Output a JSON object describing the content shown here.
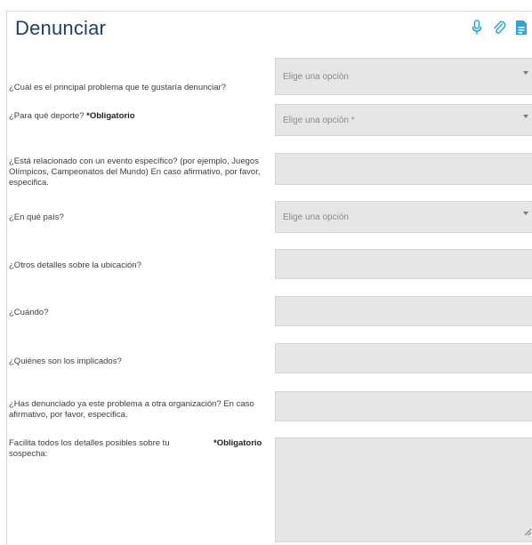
{
  "form": {
    "title": "Denunciar",
    "toolbar": {
      "icons": [
        "microphone-icon",
        "paperclip-icon",
        "document-icon"
      ],
      "accent": "#2aa7d8"
    },
    "questions": [
      {
        "label": "¿Cuál es el principal problema que te gustaría denunciar?",
        "type": "select",
        "placeholder": "Elige una opción"
      },
      {
        "label": "¿Para qué deporte?",
        "required_label": "*Obligatorio",
        "type": "select",
        "placeholder": "Elige una opción *"
      },
      {
        "label": "¿Está relacionado con un evento específico? (por ejemplo, Juegos Olímpicos, Campeonatos del Mundo) En caso afirmativo, por favor, especifica.",
        "type": "text",
        "value": ""
      },
      {
        "label": "¿En qué país?",
        "type": "select",
        "placeholder": "Elige una opción"
      },
      {
        "label": "¿Otros detalles sobre la ubicación?",
        "type": "text",
        "value": ""
      },
      {
        "label": "¿Cuándo?",
        "type": "text",
        "value": ""
      },
      {
        "label": "¿Quiénes son los implicados?",
        "type": "text",
        "value": ""
      },
      {
        "label": "¿Has denunciado ya este problema a otra organización? En caso afirmativo, por favor, especifica.",
        "type": "text",
        "value": ""
      },
      {
        "label": "Facilita todos los detalles posibles sobre tu sospecha:",
        "required_label": "*Obligatorio",
        "type": "textarea",
        "value": ""
      }
    ]
  }
}
